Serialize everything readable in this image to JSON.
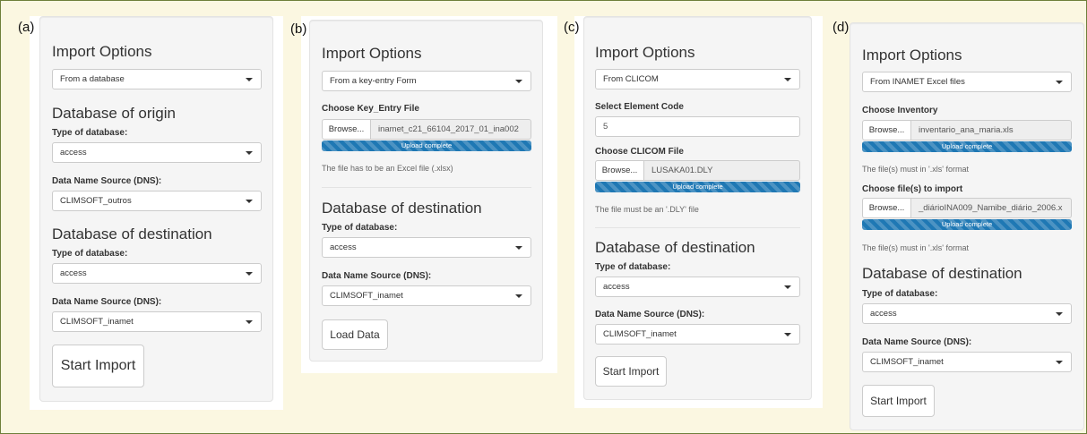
{
  "panel_a": {
    "label": "(a)",
    "title": "Import Options",
    "import_select": "From a database",
    "origin_heading": "Database of origin",
    "type_label": "Type of database:",
    "type_select": "access",
    "dns_label": "Data Name Source (DNS):",
    "dns_select": "CLIMSOFT_outros",
    "dest_heading": "Database of destination",
    "dest_type_label": "Type of database:",
    "dest_type_select": "access",
    "dest_dns_label": "Data Name Source (DNS):",
    "dest_dns_select": "CLIMSOFT_inamet",
    "button": "Start Import"
  },
  "panel_b": {
    "label": "(b)",
    "title": "Import Options",
    "import_select": "From a key-entry Form",
    "file_label": "Choose Key_Entry File",
    "browse": "Browse...",
    "file_name": "inamet_c21_66104_2017_01_ina002",
    "progress": "Upload complete",
    "note": "The file has to be an Excel file (.xlsx)",
    "dest_heading": "Database of destination",
    "dest_type_label": "Type of database:",
    "dest_type_select": "access",
    "dest_dns_label": "Data Name Source (DNS):",
    "dest_dns_select": "CLIMSOFT_inamet",
    "button": "Load Data"
  },
  "panel_c": {
    "label": "(c)",
    "title": "Import Options",
    "import_select": "From CLICOM",
    "element_label": "Select Element Code",
    "element_value": "5",
    "file_label": "Choose CLICOM File",
    "browse": "Browse...",
    "file_name": "LUSAKA01.DLY",
    "progress": "Upload complete",
    "note": "The file must be an '.DLY' file",
    "dest_heading": "Database of destination",
    "dest_type_label": "Type of database:",
    "dest_type_select": "access",
    "dest_dns_label": "Data Name Source (DNS):",
    "dest_dns_select": "CLIMSOFT_inamet",
    "button": "Start Import"
  },
  "panel_d": {
    "label": "(d)",
    "title": "Import Options",
    "import_select": "From INAMET Excel files",
    "inventory_label": "Choose Inventory",
    "browse1": "Browse...",
    "file1": "inventario_ana_maria.xls",
    "progress1": "Upload complete",
    "note1": "The file(s) must in '.xls' format",
    "files_label": "Choose file(s) to import",
    "browse2": "Browse...",
    "file2": "_diárioINA009_Namibe_diário_2006.x",
    "progress2": "Upload complete",
    "note2": "The file(s) must in '.xls' format",
    "dest_heading": "Database of destination",
    "dest_type_label": "Type of database:",
    "dest_type_select": "access",
    "dest_dns_label": "Data Name Source (DNS):",
    "dest_dns_select": "CLIMSOFT_inamet",
    "button": "Start Import"
  }
}
